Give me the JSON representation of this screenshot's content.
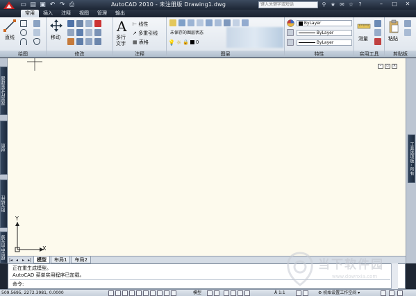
{
  "titlebar": {
    "title": "AutoCAD 2010 - 未注册版   Drawing1.dwg",
    "search_placeholder": "键入关键字或短语",
    "qat_icons": [
      "new-icon",
      "open-icon",
      "save-icon",
      "undo-icon",
      "redo-icon",
      "print-icon"
    ]
  },
  "tabs": [
    "常用",
    "插入",
    "注释",
    "视图",
    "管理",
    "输出"
  ],
  "active_tab": "常用",
  "ribbon": {
    "draw": {
      "title": "绘图",
      "line": "直线"
    },
    "modify": {
      "title": "修改",
      "move": "移动"
    },
    "annotation": {
      "title": "注释",
      "mtext": "多行\n文字",
      "linear": "线性",
      "multileader": "多重引线",
      "table": "表格"
    },
    "layers": {
      "title": "图层",
      "state": "未保存的图层状态",
      "layer_value": "0"
    },
    "properties": {
      "title": "特性",
      "color": "ByLayer",
      "linetype": "ByLayer",
      "lineweight": "ByLayer"
    },
    "utilities": {
      "title": "实用工具",
      "measure": "测量"
    },
    "clipboard": {
      "title": "剪贴板",
      "paste": "粘贴"
    }
  },
  "left_palettes": [
    "视觉样式管理器",
    "材质",
    "阳光特性",
    "模型中的光源"
  ],
  "right_palettes": [
    "工具选项板 - 所有"
  ],
  "ucs": {
    "x": "X",
    "y": "Y"
  },
  "layout_tabs": [
    "模型",
    "布局1",
    "布局2"
  ],
  "active_layout": "模型",
  "command_lines": [
    "正在重生成模型。",
    "AutoCAD 菜单实用程序已加载。",
    "命令:"
  ],
  "watermark": {
    "name": "当下软件园",
    "url": "www.downxia.com"
  },
  "statusbar": {
    "coords": "509.5695,   2272.3981,  0.0000",
    "model": "模型",
    "scale": "1:1",
    "workspace": "初始设置工作空间"
  },
  "colors": {
    "accent": "#1f2a3a",
    "canvas": "#fdfaed",
    "ribbon": "#e6ebf1"
  }
}
